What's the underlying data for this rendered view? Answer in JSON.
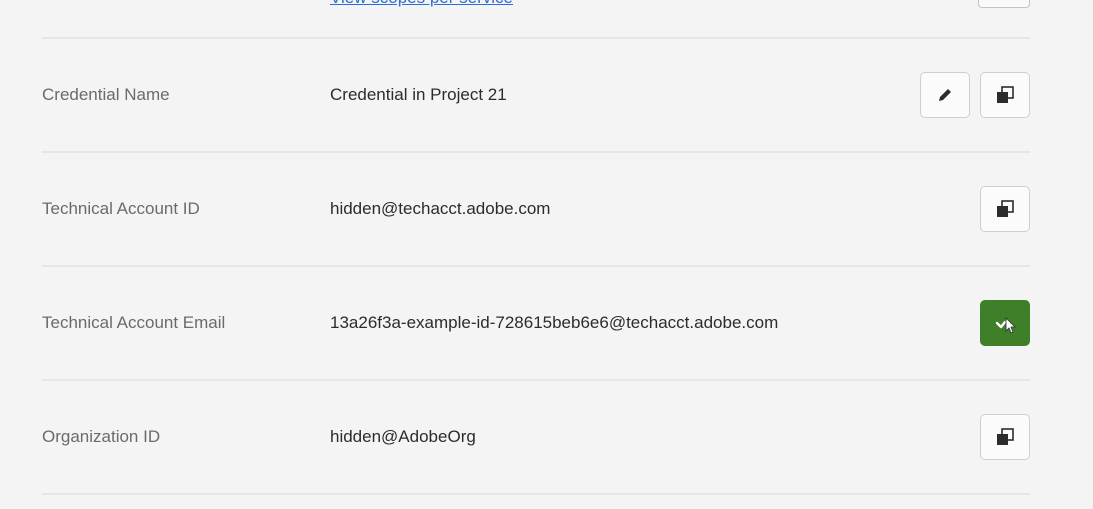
{
  "top": {
    "scopes_link": "View scopes per service"
  },
  "rows": [
    {
      "label": "Credential Name",
      "value": "Credential in Project 21",
      "actions": [
        "edit-icon",
        "copy-icon"
      ]
    },
    {
      "label": "Technical Account ID",
      "value": "hidden@techacct.adobe.com",
      "actions": [
        "copy-icon"
      ]
    },
    {
      "label": "Technical Account Email",
      "value": "13a26f3a-example-id-728615beb6e6@techacct.adobe.com",
      "actions": [
        "copied-check-icon"
      ]
    },
    {
      "label": "Organization ID",
      "value": "hidden@AdobeOrg",
      "actions": [
        "copy-icon"
      ]
    }
  ],
  "colors": {
    "copied_state_background": "#3f7f2a",
    "link": "#2d6fd6"
  }
}
